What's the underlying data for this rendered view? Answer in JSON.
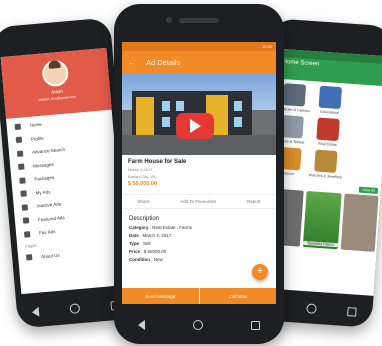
{
  "left_phone": {
    "user_name": "Arian",
    "user_email": "master_test@gmail.com",
    "menu": [
      "Home",
      "Profile",
      "Advance Search",
      "Messages",
      "Packages",
      "My Ads",
      "Inactive Ads",
      "Featured Ads",
      "Fav Ads"
    ],
    "section_label": "Pages",
    "about": "About Us"
  },
  "center_phone": {
    "status_time": "12:30",
    "title": "Ad Details",
    "ad_title": "Farm House  for Sale",
    "date": "March 4,2017",
    "location": "Banani City, Vil...",
    "price": "$ 55,000.00",
    "share": "Share",
    "favourite": "Add To Favourites",
    "report": "Report",
    "description_title": "Description",
    "category_label": "Category",
    "category_value": "Real Estate , Farms",
    "date_label": "Date",
    "date_value": "March 4, 2017",
    "type_label": "Type",
    "type_value": "Sell",
    "price_label": "Price",
    "price_value": "$ 55000.00",
    "condition_label": "Condition",
    "condition_value": "New",
    "fab": "+",
    "send_message": "Send Message",
    "call_now": "Call Now",
    "accent_color": "#f28a27"
  },
  "right_phone": {
    "title": "Home Screen",
    "categories": [
      "Computer & Laptops",
      "Educational",
      "Mobile & Tablets",
      "Real Estate",
      "Sports",
      "Watches & Jewellery"
    ],
    "ads_label": "Ads",
    "view_all": "View All",
    "ad_card_label": "Beautiful Parrot",
    "accent_color": "#2e9e4e"
  }
}
